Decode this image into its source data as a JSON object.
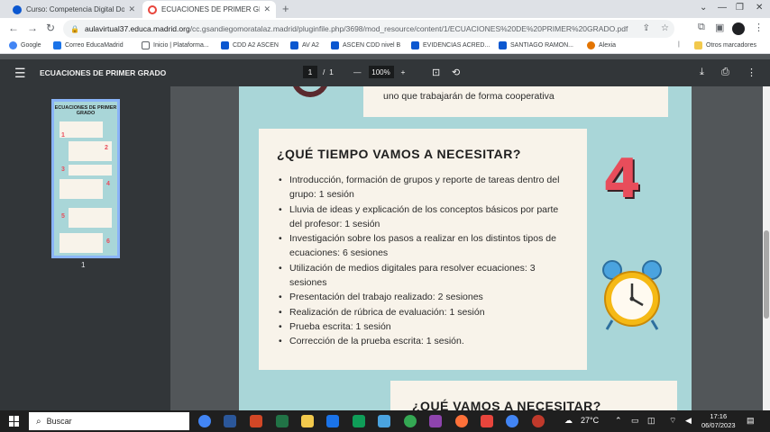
{
  "browser": {
    "tabs": [
      {
        "title": "Curso: Competencia Digital Doc",
        "active": false
      },
      {
        "title": "ECUACIONES DE PRIMER GRADO",
        "active": true
      }
    ],
    "new_tab_icon": "plus-icon",
    "url_host": "aulavirtual37.educa.madrid.org",
    "url_path": "/cc.gsandiegomoratalaz.madrid/pluginfile.php/3698/mod_resource/content/1/ECUACIONES%20DE%20PRIMER%20GRADO.pdf",
    "bookmarks": [
      {
        "label": "Google",
        "color": "#4285f4"
      },
      {
        "label": "Correo EducaMadrid",
        "color": "#1a73e8"
      },
      {
        "label": "Inicio | Plataforma...",
        "color": "#0b57d0"
      },
      {
        "label": "CDD A2 ASCEN",
        "color": "#0b57d0"
      },
      {
        "label": "AV A2",
        "color": "#0b57d0"
      },
      {
        "label": "ASCEN CDD nivel B",
        "color": "#0b57d0"
      },
      {
        "label": "EVIDENCIAS ACRED...",
        "color": "#0b57d0"
      },
      {
        "label": "SANTIAGO RAMON...",
        "color": "#0b57d0"
      },
      {
        "label": "Alexia",
        "color": "#e37400"
      },
      {
        "label": "Otros marcadores",
        "color": "#f2c94c"
      }
    ]
  },
  "pdf": {
    "title": "ECUACIONES DE PRIMER GRADO",
    "current_page": "1",
    "page_separator": "/",
    "total_pages": "1",
    "zoom": "100%",
    "thumbnail_label": "1",
    "thumbnail_title": "ECUACIONES DE PRIMER GRADO"
  },
  "document": {
    "top_card_text": "uno que trabajarán de forma cooperativa",
    "section_heading": "¿QUÉ TIEMPO VAMOS A NECESITAR?",
    "section_number": "4",
    "items": [
      "Introducción, formación de grupos y reporte de tareas dentro del grupo: 1 sesión",
      "Lluvia de ideas y explicación de los conceptos básicos por parte del profesor: 1 sesión",
      "Investigación sobre los pasos a realizar en los distintos tipos de ecuaciones: 6 sesiones",
      "Utilización de medios digitales para resolver ecuaciones: 3 sesiones",
      "Presentación del trabajo realizado: 2 sesiones",
      "Realización de rúbrica de evaluación: 1 sesión",
      "Prueba escrita: 1 sesión",
      "Corrección de la prueba escrita: 1 sesión."
    ],
    "next_heading": "¿QUÉ VAMOS A NECESITAR?"
  },
  "taskbar": {
    "search_placeholder": "Buscar",
    "temperature": "27°C",
    "time": "17:16",
    "date": "06/07/2023"
  }
}
